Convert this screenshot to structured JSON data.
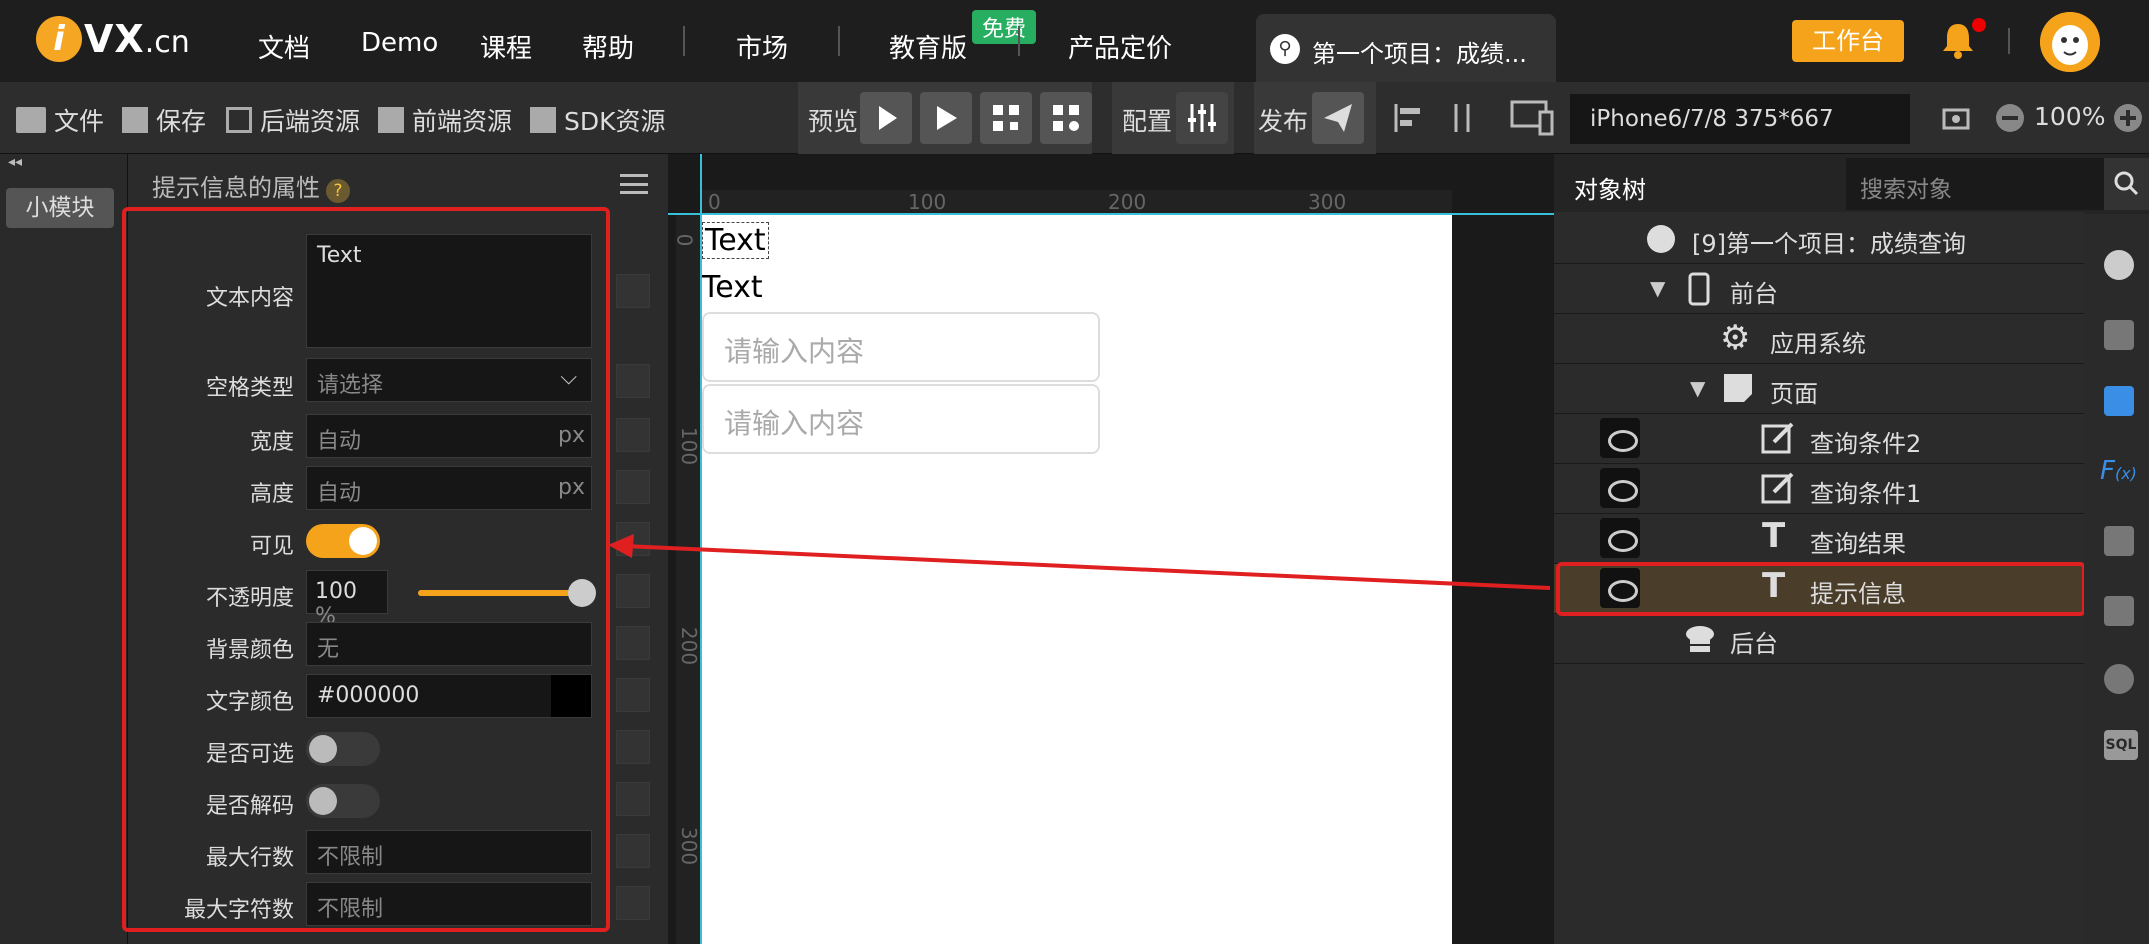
{
  "topbar": {
    "logo_brand": "VX",
    "logo_suffix": ".cn",
    "nav": [
      "文档",
      "Demo",
      "课程",
      "帮助",
      "市场",
      "教育版",
      "产品定价"
    ],
    "free_badge": "免费",
    "project_tab": "第一个项目：成绩...",
    "workbench": "工作台"
  },
  "toolbar": {
    "file": "文件",
    "save": "保存",
    "backend_res": "后端资源",
    "frontend_res": "前端资源",
    "sdk_res": "SDK资源",
    "preview": "预览",
    "config": "配置",
    "publish": "发布",
    "device": "iPhone6/7/8 375*667",
    "zoom": "100%"
  },
  "left": {
    "module_button": "小模块"
  },
  "props": {
    "title": "提示信息的属性",
    "help": "?",
    "text_content_label": "文本内容",
    "text_content_value": "Text",
    "space_type_label": "空格类型",
    "space_type_placeholder": "请选择",
    "width_label": "宽度",
    "width_value": "自动",
    "height_label": "高度",
    "height_value": "自动",
    "unit": "px",
    "visible_label": "可见",
    "opacity_label": "不透明度",
    "opacity_value": "100",
    "opacity_unit": "%",
    "opacity_level": 1.0,
    "bg_color_label": "背景颜色",
    "bg_color_value": "无",
    "text_color_label": "文字颜色",
    "text_color_value": "#000000",
    "selectable_label": "是否可选",
    "decode_label": "是否解码",
    "max_lines_label": "最大行数",
    "max_lines_value": "不限制",
    "max_chars_label": "最大字符数",
    "max_chars_value": "不限制"
  },
  "canvas": {
    "ruler_x": [
      "0",
      "100",
      "200",
      "300"
    ],
    "ruler_y": [
      "0",
      "100",
      "200",
      "300"
    ],
    "text1": "Text",
    "text2": "Text",
    "input1_placeholder": "请输入内容",
    "input2_placeholder": "请输入内容"
  },
  "tree": {
    "title": "对象树",
    "search_placeholder": "搜索对象",
    "items": [
      {
        "label": "[9]第一个项目：成绩查询"
      },
      {
        "label": "前台"
      },
      {
        "label": "应用系统"
      },
      {
        "label": "页面"
      },
      {
        "label": "查询条件2"
      },
      {
        "label": "查询条件1"
      },
      {
        "label": "查询结果"
      },
      {
        "label": "提示信息"
      },
      {
        "label": "后台"
      }
    ]
  },
  "colors": {
    "accent": "#f5a31a",
    "selection_frame": "#e02020",
    "free_badge": "#27ae60",
    "guide_line": "#38c0d8"
  }
}
